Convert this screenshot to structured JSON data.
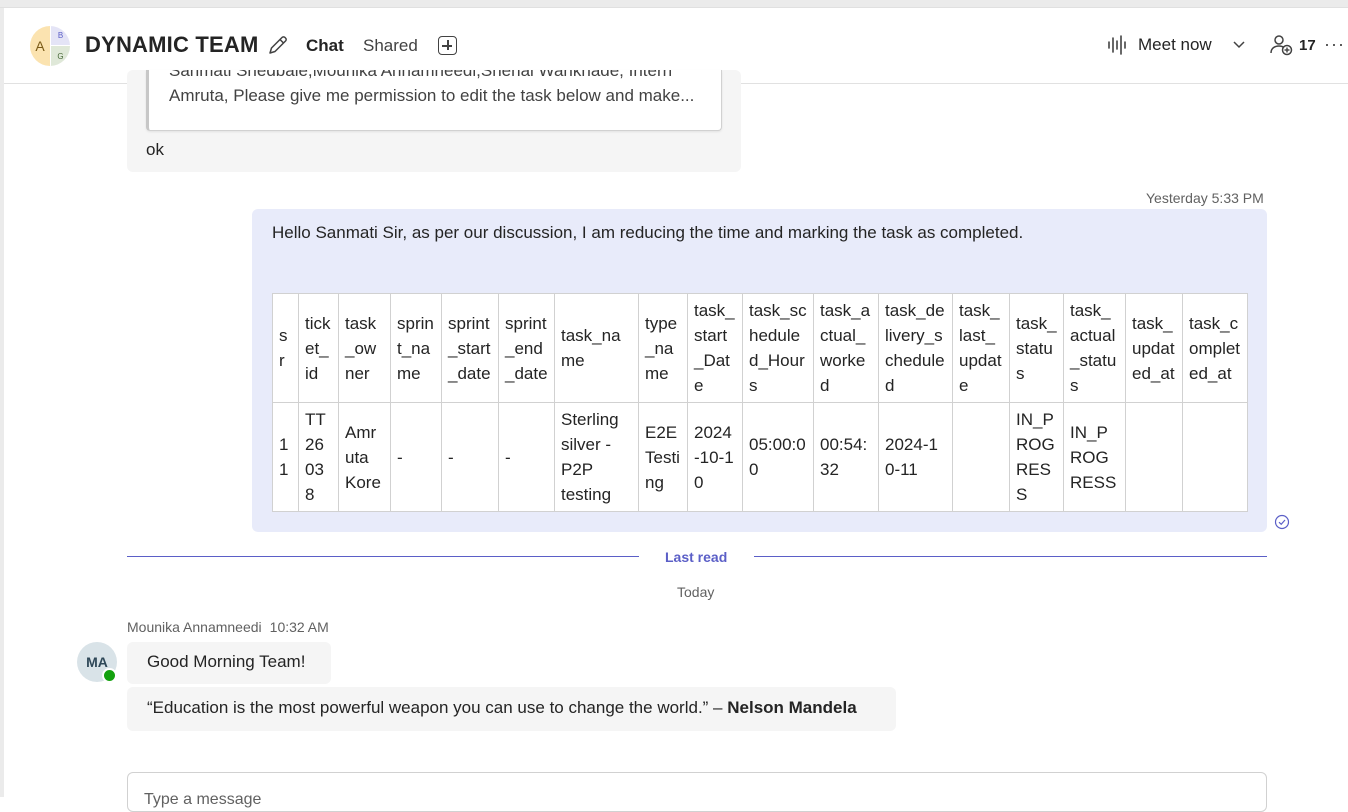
{
  "header": {
    "avatar_letters": [
      "A",
      "B",
      "G"
    ],
    "team_name": "DYNAMIC TEAM",
    "tabs": [
      "Chat",
      "Shared"
    ],
    "meet_now_label": "Meet now",
    "participant_count": "17",
    "more_label": "···"
  },
  "previous_message": {
    "quote_line1": "Sanmati Shedbale,Mounika Annamneedi,Shehal Wankhade, Intern",
    "quote_line2": "Amruta, Please give me permission to edit the task below and make...",
    "reply": "ok"
  },
  "my_message": {
    "timestamp": "Yesterday 5:33 PM",
    "text": "Hello Sanmati Sir, as per our discussion, I am reducing the time and marking the task as completed.",
    "table": {
      "headers": [
        "sr",
        "ticket_id",
        "task_owner",
        "sprint_name",
        "sprint_start_date",
        "sprint_end_date",
        "task_name",
        "type_name",
        "task_start_Date",
        "task_scheduled_Hours",
        "task_actual_worked",
        "task_delivery_scheduled",
        "task_last_update",
        "task_status",
        "task_actual_status",
        "task_updated_at",
        "task_completed_at"
      ],
      "rows": [
        [
          "11",
          "TT26038",
          "Amruta Kore",
          "-",
          "-",
          "-",
          "Sterling silver - P2P testing",
          "E2E Testing",
          "2024-10-10",
          "05:00:00",
          "00:54:32",
          "2024-10-11",
          "",
          "IN_PROGRESS",
          "IN_PROGRESS",
          "",
          ""
        ]
      ]
    }
  },
  "divider": {
    "last_read": "Last read",
    "today": "Today"
  },
  "new_messages": {
    "sender": "Mounika Annamneedi",
    "time": "10:32 AM",
    "avatar_initials": "MA",
    "presence": "available",
    "greeting": "Good Morning Team!",
    "quote_text": "“Education is the most powerful weapon you can use to change the world.” – ",
    "quote_author": "Nelson Mandela"
  },
  "compose": {
    "placeholder": "Type a message"
  },
  "colors": {
    "accent": "#5b5fc7",
    "bubble_self": "#e8ebfa",
    "bubble_other": "#f5f5f5",
    "presence_green": "#13a10e"
  }
}
